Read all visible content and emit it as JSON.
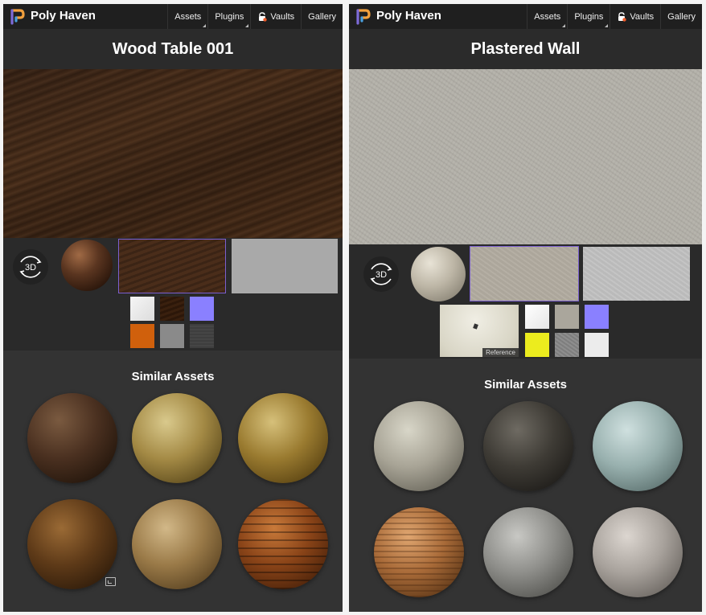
{
  "left": {
    "brand": "Poly Haven",
    "nav": [
      "Assets",
      "Plugins",
      "Vaults",
      "Gallery"
    ],
    "title": "Wood Table 001",
    "btn3d": "3D",
    "similar_title": "Similar Assets"
  },
  "right": {
    "brand": "Poly Haven",
    "nav": [
      "Assets",
      "Plugins",
      "Vaults",
      "Gallery"
    ],
    "title": "Plastered Wall",
    "btn3d": "3D",
    "reference_label": "Reference",
    "similar_title": "Similar Assets"
  },
  "icons": [
    "polyhaven-logo-icon",
    "lock-icon",
    "rotate-3d-icon",
    "expand-icon"
  ],
  "colors": {
    "panel_bg": "#2b2b2b",
    "navbar_bg": "#1f1f1f",
    "selection_outline": "#7a5fd0"
  }
}
